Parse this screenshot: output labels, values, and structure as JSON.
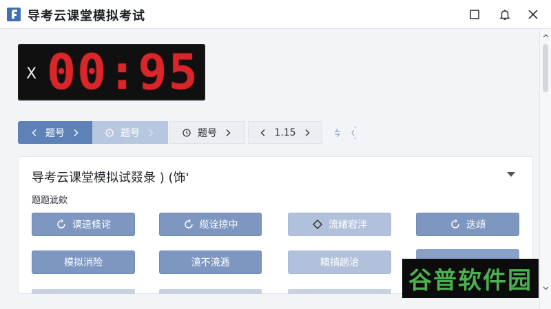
{
  "window": {
    "title": "导考云课堂模拟考试"
  },
  "timer": {
    "prefix": "X",
    "display": "00:95"
  },
  "toolbar": {
    "items": [
      {
        "label": "题号"
      },
      {
        "label": "题号"
      },
      {
        "label": "题号"
      },
      {
        "label": "1.15"
      }
    ]
  },
  "card": {
    "title": "导考云课堂模拟试叕彔 ) (饰'",
    "section_label": "题题泚欸",
    "options": [
      {
        "label": "谪逵倐诧"
      },
      {
        "label": "缆诠掠中"
      },
      {
        "label": "流绪宕泮"
      },
      {
        "label": "迭頉"
      },
      {
        "label": "模拟消险"
      },
      {
        "label": "滰不滰逓"
      },
      {
        "label": "精掯趟洽"
      }
    ]
  },
  "watermark": {
    "text": "谷普软件园"
  },
  "colors": {
    "accent": "#5e82b8",
    "accent_light": "#b7c7df",
    "timer_digits": "#d8262a",
    "watermark": "#4caf50"
  }
}
